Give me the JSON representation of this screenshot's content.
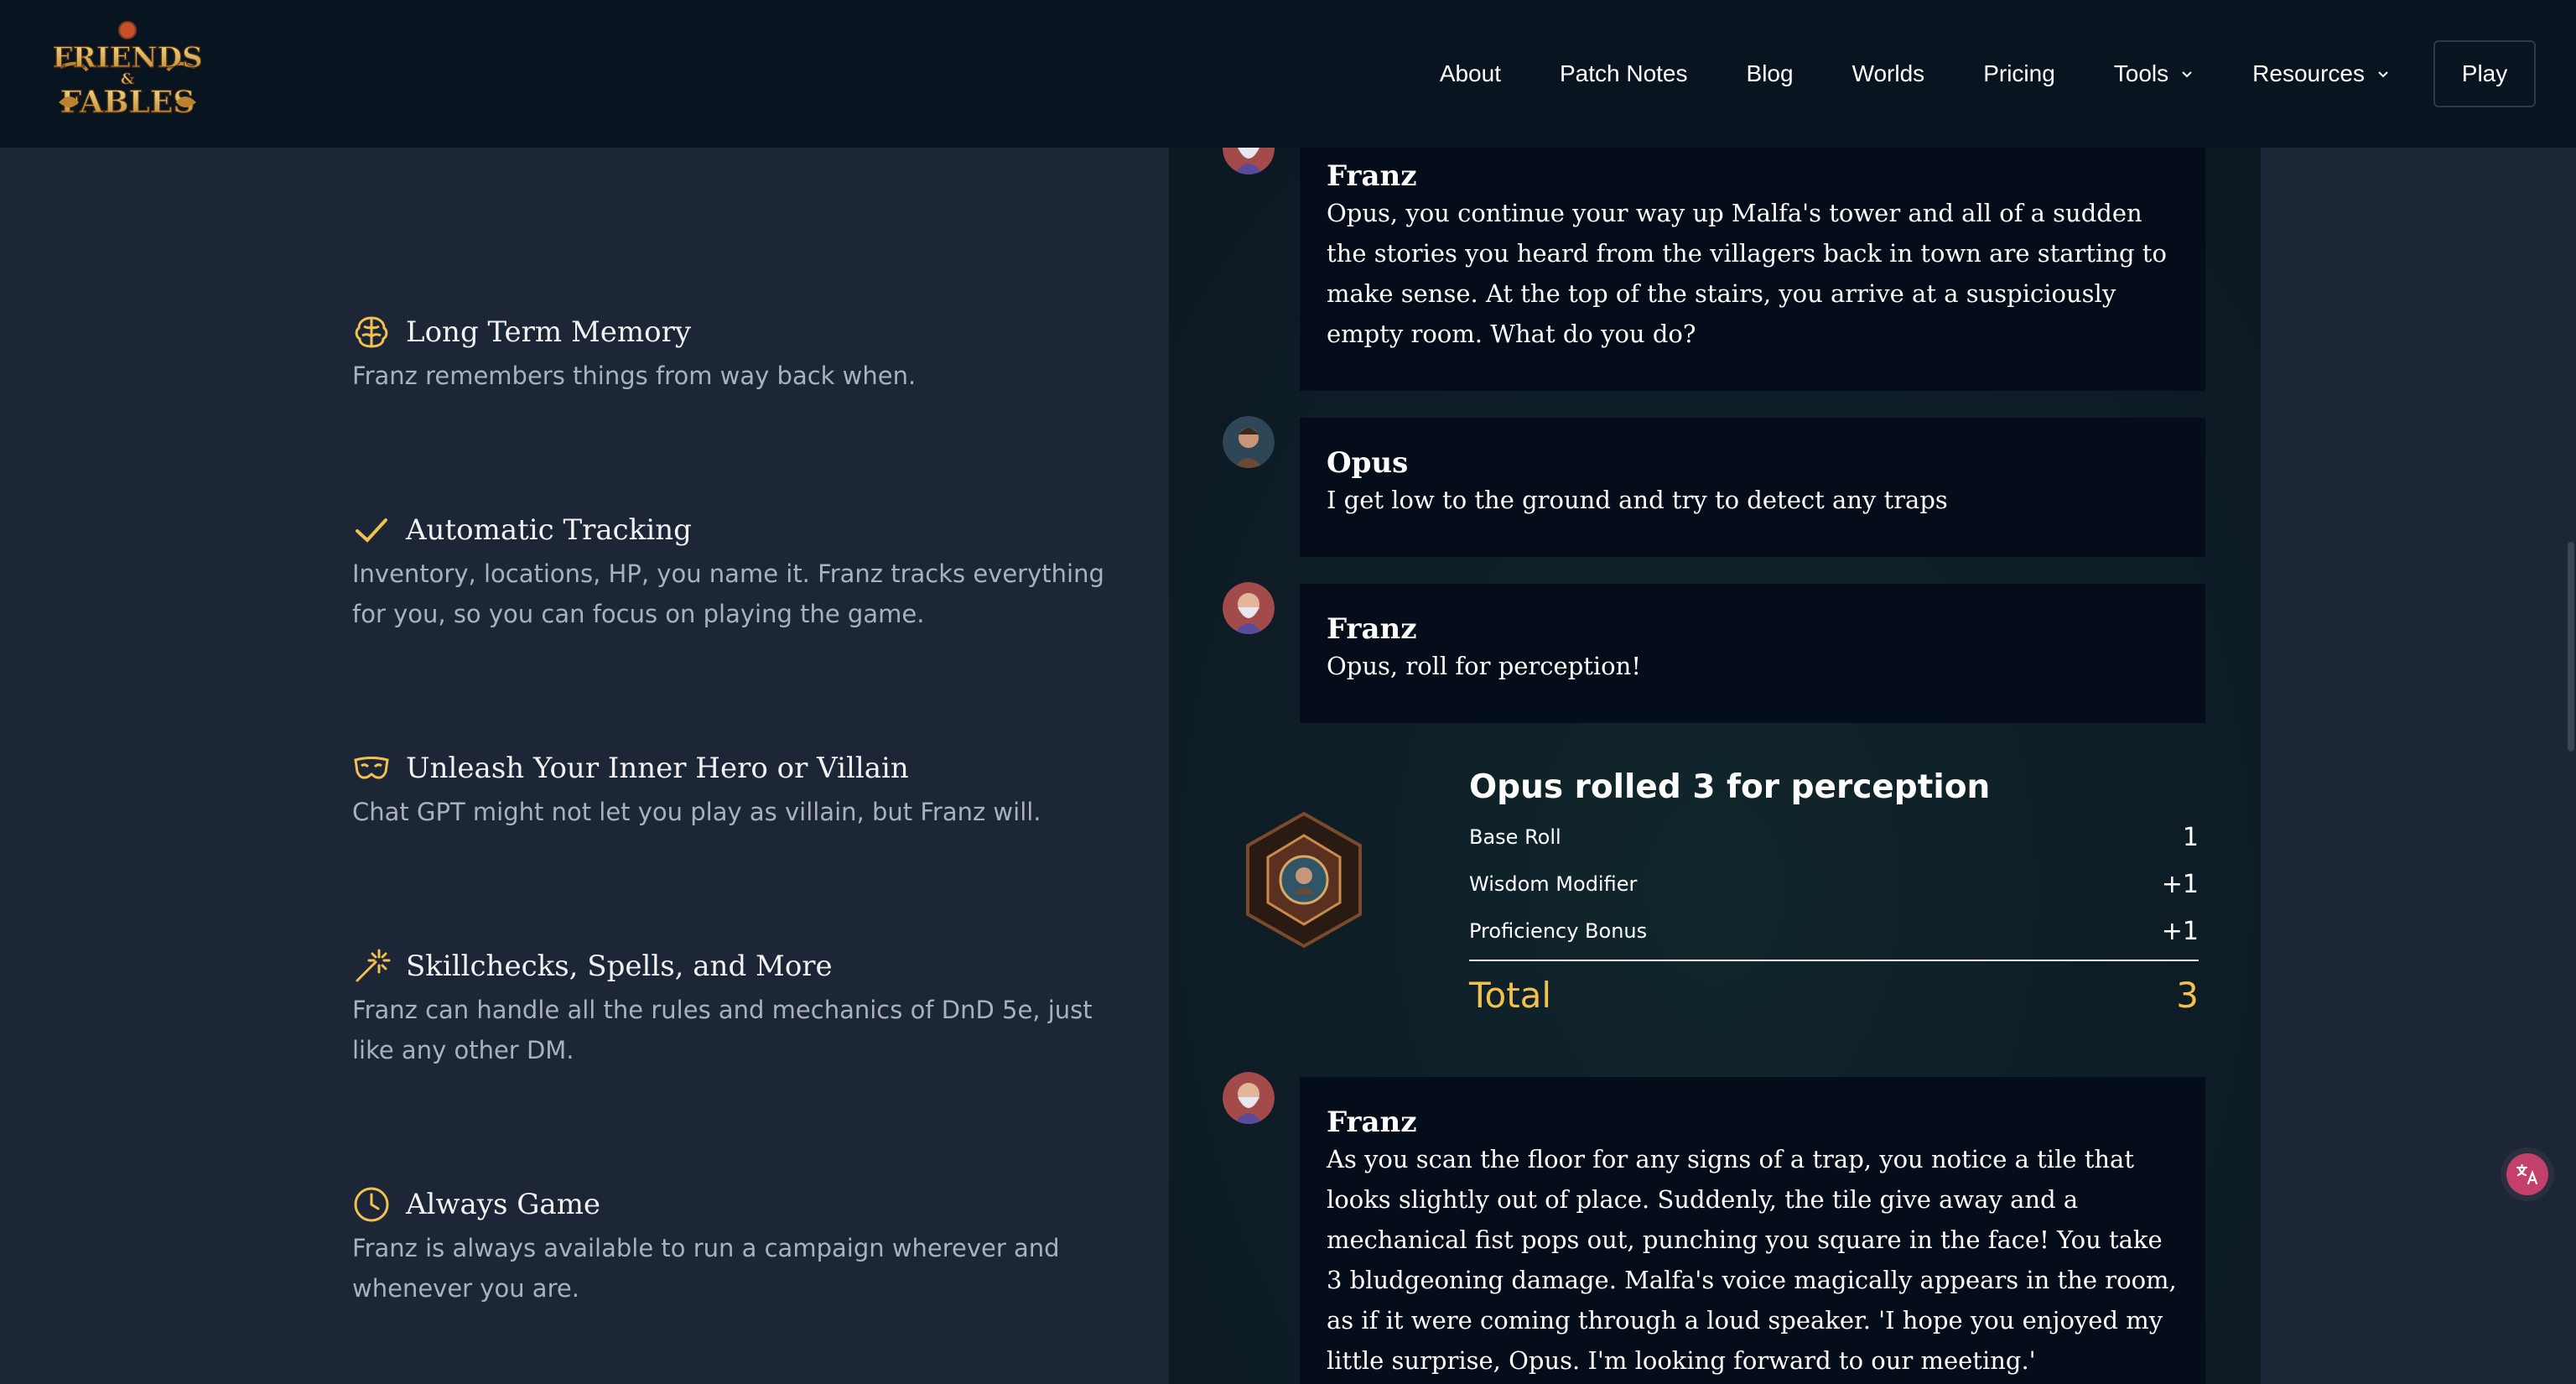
{
  "brand": {
    "logo_text": [
      "FRIENDS",
      "&",
      "FABLES"
    ]
  },
  "nav": {
    "items": [
      {
        "label": "About"
      },
      {
        "label": "Patch Notes"
      },
      {
        "label": "Blog"
      },
      {
        "label": "Worlds"
      },
      {
        "label": "Pricing"
      },
      {
        "label": "Tools",
        "dropdown": true
      },
      {
        "label": "Resources",
        "dropdown": true
      }
    ],
    "play_label": "Play"
  },
  "features": [
    {
      "icon": "brain-icon",
      "title": "Long Term Memory",
      "desc": "Franz remembers things from way back when."
    },
    {
      "icon": "checkmark-icon",
      "title": "Automatic Tracking",
      "desc": "Inventory, locations, HP, you name it. Franz tracks everything for you, so you can focus on playing the game."
    },
    {
      "icon": "mask-icon",
      "title": "Unleash Your Inner Hero or Villain",
      "desc": "Chat GPT might not let you play as villain, but Franz will."
    },
    {
      "icon": "magic-wand-icon",
      "title": "Skillchecks, Spells, and More",
      "desc": "Franz can handle all the rules and mechanics of DnD 5e, just like any other DM."
    },
    {
      "icon": "clock-icon",
      "title": "Always Game",
      "desc": "Franz is always available to run a campaign wherever and whenever you are."
    }
  ],
  "chat": {
    "messages": [
      {
        "sender": "Franz",
        "text": "Opus, you continue your way up Malfa's tower and all of a sudden the stories you heard from the villagers back in town are starting to make sense. At the top of the stairs, you arrive at a suspiciously empty room. What do you do?"
      },
      {
        "sender": "Opus",
        "text": "I get low to the ground and try to detect any traps"
      },
      {
        "sender": "Franz",
        "text": "Opus, roll for perception!"
      },
      {
        "sender": "Franz",
        "text": "As you scan the floor for any signs of a trap, you notice a tile that looks slightly out of place. Suddenly, the tile give away and a mechanical fist pops out, punching you square in the face! You take 3 bludgeoning damage. Malfa's voice magically appears in the room, as if it were coming through a loud speaker. 'I hope you enjoyed my little surprise, Opus. I'm looking forward to our meeting.'"
      }
    ],
    "roll": {
      "title": "Opus rolled 3 for perception",
      "rows": [
        {
          "label": "Base Roll",
          "value": "1"
        },
        {
          "label": "Wisdom Modifier",
          "value": "+1"
        },
        {
          "label": "Proficiency Bonus",
          "value": "+1"
        }
      ],
      "total_label": "Total",
      "total_value": "3"
    }
  },
  "colors": {
    "background": "#1c2637",
    "header": "#081520",
    "message_bg": "#060d1a",
    "total_accent": "#f2c14e",
    "translate_widget": "#c2406a"
  }
}
